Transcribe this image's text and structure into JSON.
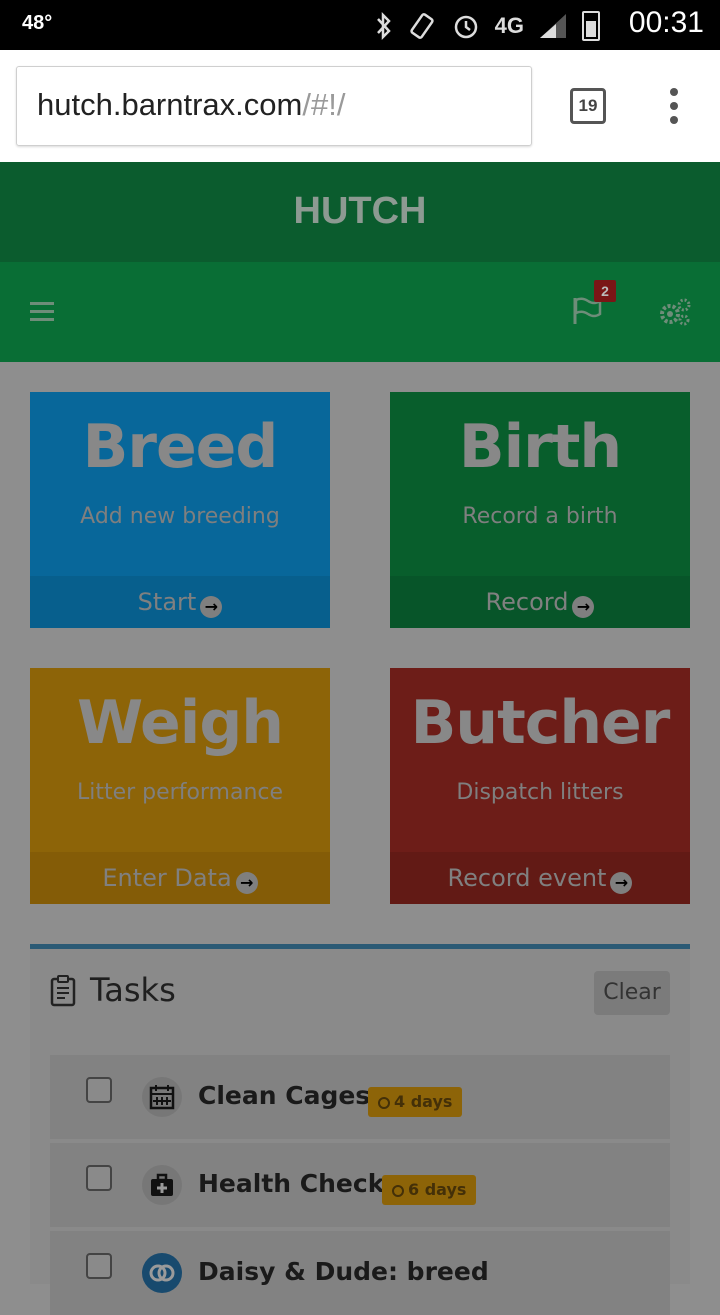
{
  "status_bar": {
    "temperature": "48°",
    "network": "4G",
    "time": "00:31",
    "icons": [
      "bluetooth-icon",
      "vibrate-icon",
      "alarm-icon",
      "lte-icon",
      "signal-icon",
      "battery-icon"
    ]
  },
  "browser": {
    "url_domain": "hutch.barntrax.com",
    "url_path": "/#!/",
    "tab_count": "19"
  },
  "app": {
    "title": "HUTCH",
    "notification_count": "2"
  },
  "tiles": [
    {
      "title": "Breed",
      "subtitle": "Add new breeding",
      "action": "Start"
    },
    {
      "title": "Birth",
      "subtitle": "Record a birth",
      "action": "Record"
    },
    {
      "title": "Weigh",
      "subtitle": "Litter performance",
      "action": "Enter Data"
    },
    {
      "title": "Butcher",
      "subtitle": "Dispatch litters",
      "action": "Record event"
    }
  ],
  "tasks": {
    "title": "Tasks",
    "clear_label": "Clear",
    "items": [
      {
        "label": "Clean Cages",
        "due": "4 days",
        "icon": "calendar-icon"
      },
      {
        "label": "Health Check",
        "due": "6 days",
        "icon": "medkit-icon"
      },
      {
        "label": "Daisy & Dude: breed",
        "due": "",
        "icon": "breed-rings-icon"
      }
    ]
  },
  "colors": {
    "breed": "#08679a",
    "birth": "#085e2c",
    "weigh": "#8d6408",
    "butcher": "#6d1d18",
    "header": "#0b5c2e",
    "nav": "#096e35"
  }
}
